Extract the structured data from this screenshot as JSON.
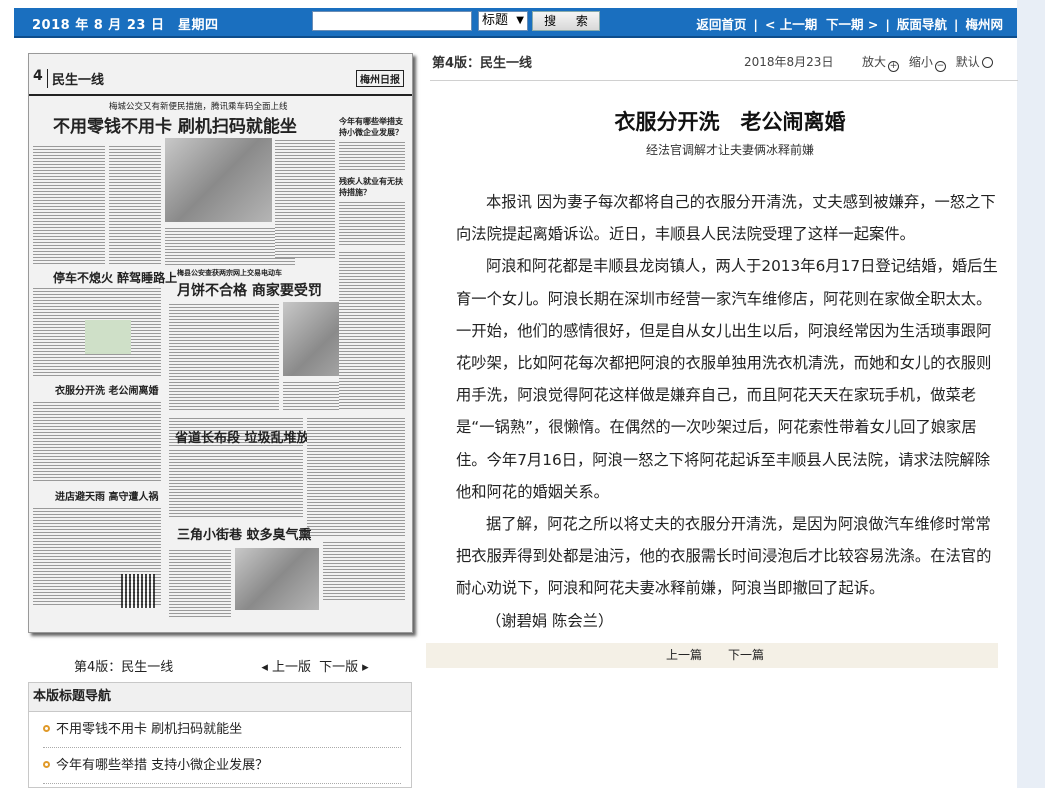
{
  "topbar": {
    "date": "2018 年 8 月 23 日　星期四",
    "search_placeholder": "",
    "search_scope": "标题",
    "search_button": "搜 索",
    "nav": [
      "返回首页",
      "< 上一期",
      "下一期 >",
      "版面导航",
      "梅州网"
    ]
  },
  "paper": {
    "page_no": "4",
    "page_name": "民生一线",
    "logo": "梅州日报",
    "kicker": "梅城公交又有新便民措施，腾讯乘车码全面上线",
    "headline_main": "不用零钱不用卡 刷机扫码就能坐",
    "headlines": [
      "今年有哪些举措支持小微企业发展？",
      "残疾人就业有无扶持措施？",
      "停车不熄火 醉驾睡路上",
      "梅县公安查获两宗网上交易电动车",
      "月饼不合格 商家要受罚",
      "衣服分开洗 老公闹离婚",
      "进店避天雨 高守遭人祸",
      "省道长布段 垃圾乱堆放",
      "三角小街巷 蚊多臭气熏"
    ]
  },
  "below_paper": {
    "page_label": "第4版：民生一线",
    "prev_page": "上一版",
    "next_page": "下一版"
  },
  "navbox": {
    "title": "本版标题导航",
    "items": [
      "不用零钱不用卡 刷机扫码就能坐",
      "今年有哪些举措 支持小微企业发展？"
    ]
  },
  "article": {
    "edition": "第4版：民生一线",
    "date": "2018年8月23日",
    "zoom_in": "放大",
    "zoom_out": "缩小",
    "zoom_default": "默认",
    "title": "衣服分开洗　老公闹离婚",
    "subtitle": "经法官调解才让夫妻俩冰释前嫌",
    "paragraphs": [
      "本报讯 因为妻子每次都将自己的衣服分开清洗，丈夫感到被嫌弃，一怒之下向法院提起离婚诉讼。近日，丰顺县人民法院受理了这样一起案件。",
      "阿浪和阿花都是丰顺县龙岗镇人，两人于2013年6月17日登记结婚，婚后生育一个女儿。阿浪长期在深圳市经营一家汽车维修店，阿花则在家做全职太太。一开始，他们的感情很好，但是自从女儿出生以后，阿浪经常因为生活琐事跟阿花吵架，比如阿花每次都把阿浪的衣服单独用洗衣机清洗，而她和女儿的衣服则用手洗，阿浪觉得阿花这样做是嫌弃自己，而且阿花天天在家玩手机，做菜老是“一锅熟”，很懒惰。在偶然的一次吵架过后，阿花索性带着女儿回了娘家居住。今年7月16日，阿浪一怒之下将阿花起诉至丰顺县人民法院，请求法院解除他和阿花的婚姻关系。",
      "据了解，阿花之所以将丈夫的衣服分开清洗，是因为阿浪做汽车维修时常常把衣服弄得到处都是油污，他的衣服需长时间浸泡后才比较容易洗涤。在法官的耐心劝说下，阿浪和阿花夫妻冰释前嫌，阿浪当即撤回了起诉。"
    ],
    "author": "（谢碧娟 陈会兰）",
    "prev_article": "上一篇",
    "next_article": "下一篇"
  }
}
